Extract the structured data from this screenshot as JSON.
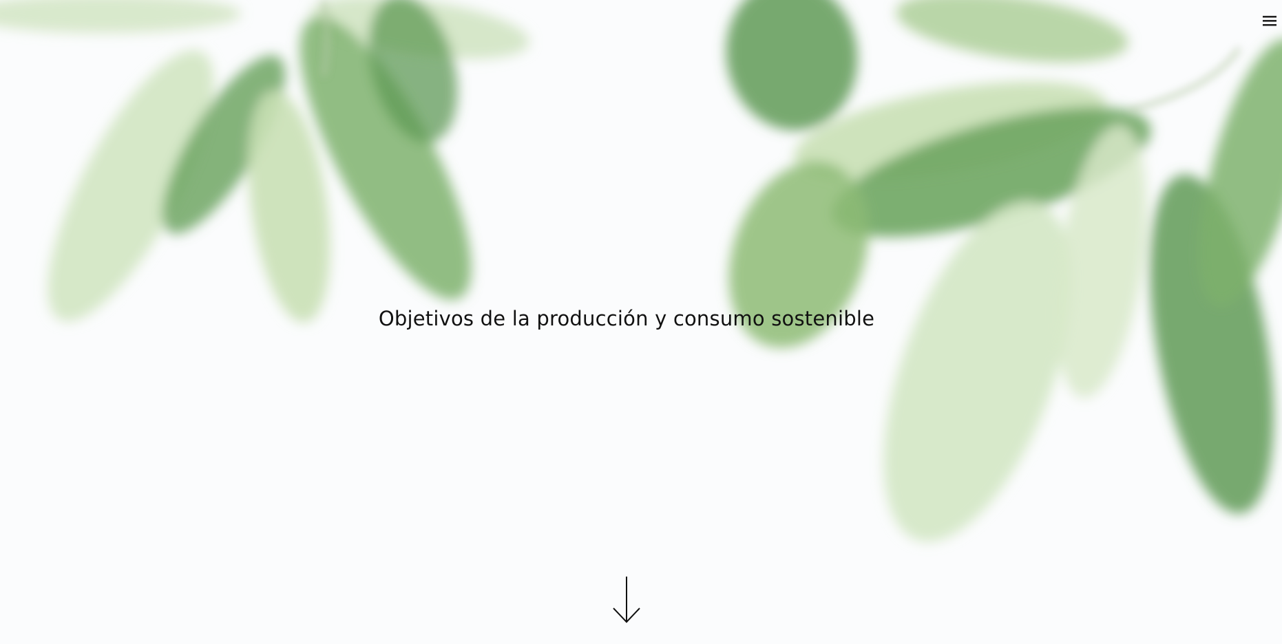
{
  "hero": {
    "title": "Objetivos de la producción y consumo sostenible"
  },
  "nav": {
    "menu_icon": "hamburger-menu-icon"
  },
  "scroll": {
    "icon": "arrow-down-icon"
  },
  "colors": {
    "background": "#fbfcfd",
    "leaf_dark": "#5f9a55",
    "leaf_mid": "#8dbb74",
    "leaf_light": "#c9e0b5",
    "text": "#111111"
  }
}
